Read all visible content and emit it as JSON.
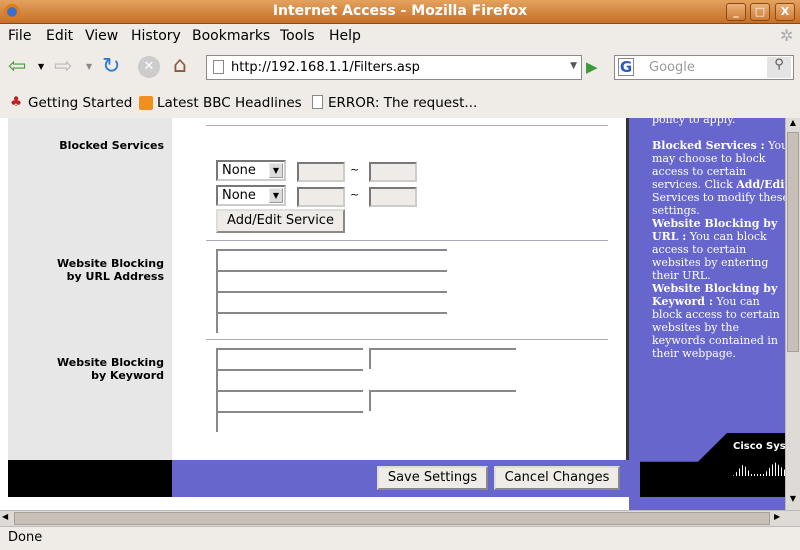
{
  "window": {
    "title": "Internet Access - Mozilla Firefox",
    "min": "_",
    "max": "□",
    "close": "X"
  },
  "menu": [
    "File",
    "Edit",
    "View",
    "History",
    "Bookmarks",
    "Tools",
    "Help"
  ],
  "nav": {
    "url": "http://192.168.1.1/Filters.asp",
    "search_placeholder": "Google"
  },
  "bookmarks": [
    "Getting Started",
    "Latest BBC Headlines",
    "ERROR: The request..."
  ],
  "form": {
    "blocked_services_label": "Blocked Services",
    "services": [
      {
        "value": "None",
        "sep": "~"
      },
      {
        "value": "None",
        "sep": "~"
      }
    ],
    "add_edit_label": "Add/Edit Service",
    "url_label_1": "Website Blocking",
    "url_label_2": "by URL Address",
    "kw_label_1": "Website Blocking",
    "kw_label_2": "by Keyword",
    "save_label": "Save Settings",
    "cancel_label": "Cancel Changes"
  },
  "help": {
    "top": "policy to apply.",
    "bs_title": "Blocked Services :",
    "bs_text1": " You may choose to block access to certain services. Click ",
    "bs_bold": "Add/Edit",
    "bs_text2": " Services to modify these settings.",
    "url_title": "Website Blocking by URL :",
    "url_text": " You can block access to certain websites by entering their URL.",
    "kw_title": "Website Blocking by Keyword :",
    "kw_text": " You can block access to certain websites by the keywords contained in their webpage.",
    "logo": "Cisco Systems"
  },
  "status": "Done",
  "colors": {
    "panel": "#6666cc",
    "gray": "#e7e7e7"
  }
}
